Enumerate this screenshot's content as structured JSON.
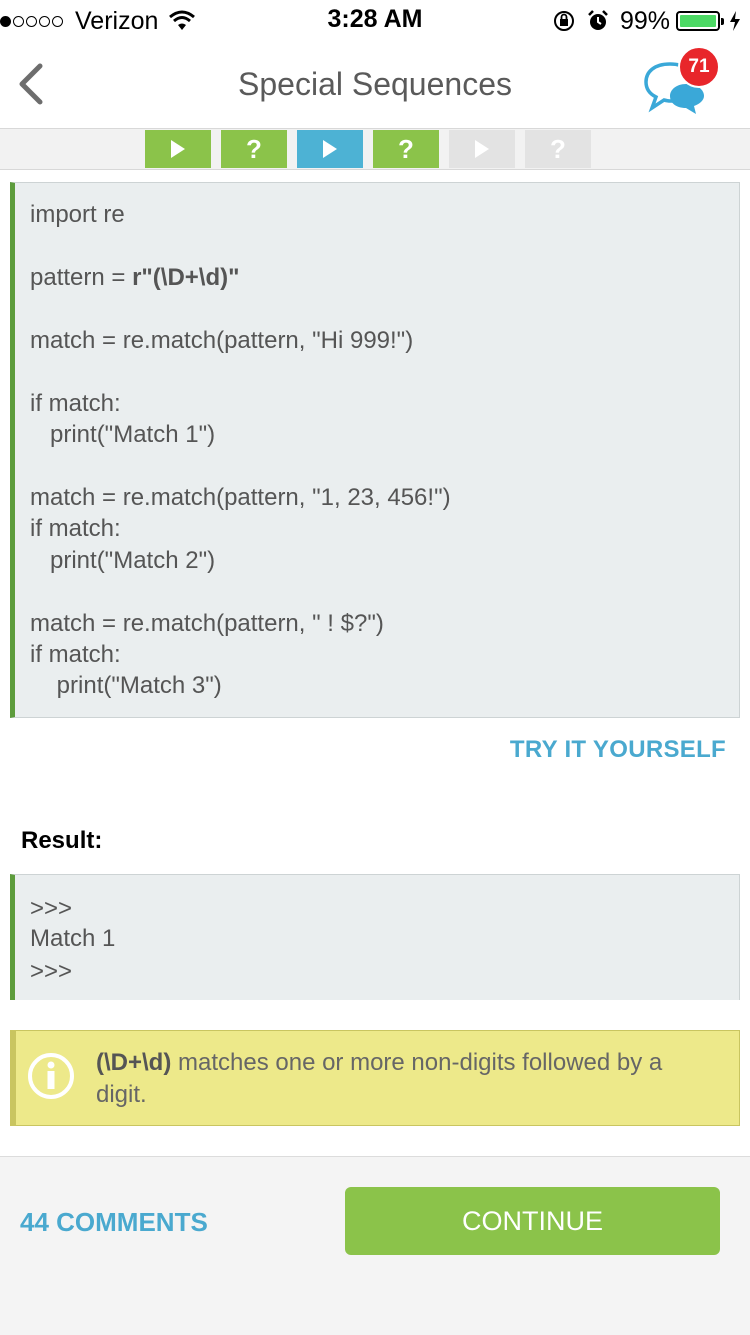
{
  "status": {
    "carrier": "Verizon",
    "time": "3:28 AM",
    "battery": "99%",
    "colors": {
      "battery_fill": "#4cd964"
    }
  },
  "nav": {
    "title": "Special Sequences",
    "back_icon": "chevron-left-icon",
    "chat_icon": "chat-bubbles-icon",
    "badge_count": "71"
  },
  "progress": {
    "steps": [
      {
        "type": "play",
        "state": "done"
      },
      {
        "type": "quiz",
        "label": "?",
        "state": "done"
      },
      {
        "type": "play",
        "state": "current"
      },
      {
        "type": "quiz",
        "label": "?",
        "state": "done"
      },
      {
        "type": "play",
        "state": "locked"
      },
      {
        "type": "quiz",
        "label": "?",
        "state": "locked"
      }
    ]
  },
  "code": {
    "line1": "import re",
    "line2_prefix": "pattern = ",
    "line2_bold": "r\"(\\D+\\d)\"",
    "line3": "match = re.match(pattern, \"Hi 999!\")",
    "line4": "if match:",
    "line5": "   print(\"Match 1\")",
    "line6": "match = re.match(pattern, \"1, 23, 456!\")",
    "line7": "if match:",
    "line8": "   print(\"Match 2\")",
    "line9": "match = re.match(pattern, \" ! $?\")",
    "line10": "if match:",
    "line11": "    print(\"Match 3\")"
  },
  "try_label": "TRY IT YOURSELF",
  "result": {
    "label": "Result:",
    "line1": ">>>",
    "line2": "Match 1",
    "line3": ">>>"
  },
  "note": {
    "icon": "info-icon",
    "bold": "(\\D+\\d)",
    "text": " matches one or more non-digits followed by a digit."
  },
  "footer": {
    "comments": "44 COMMENTS",
    "continue": "CONTINUE"
  }
}
